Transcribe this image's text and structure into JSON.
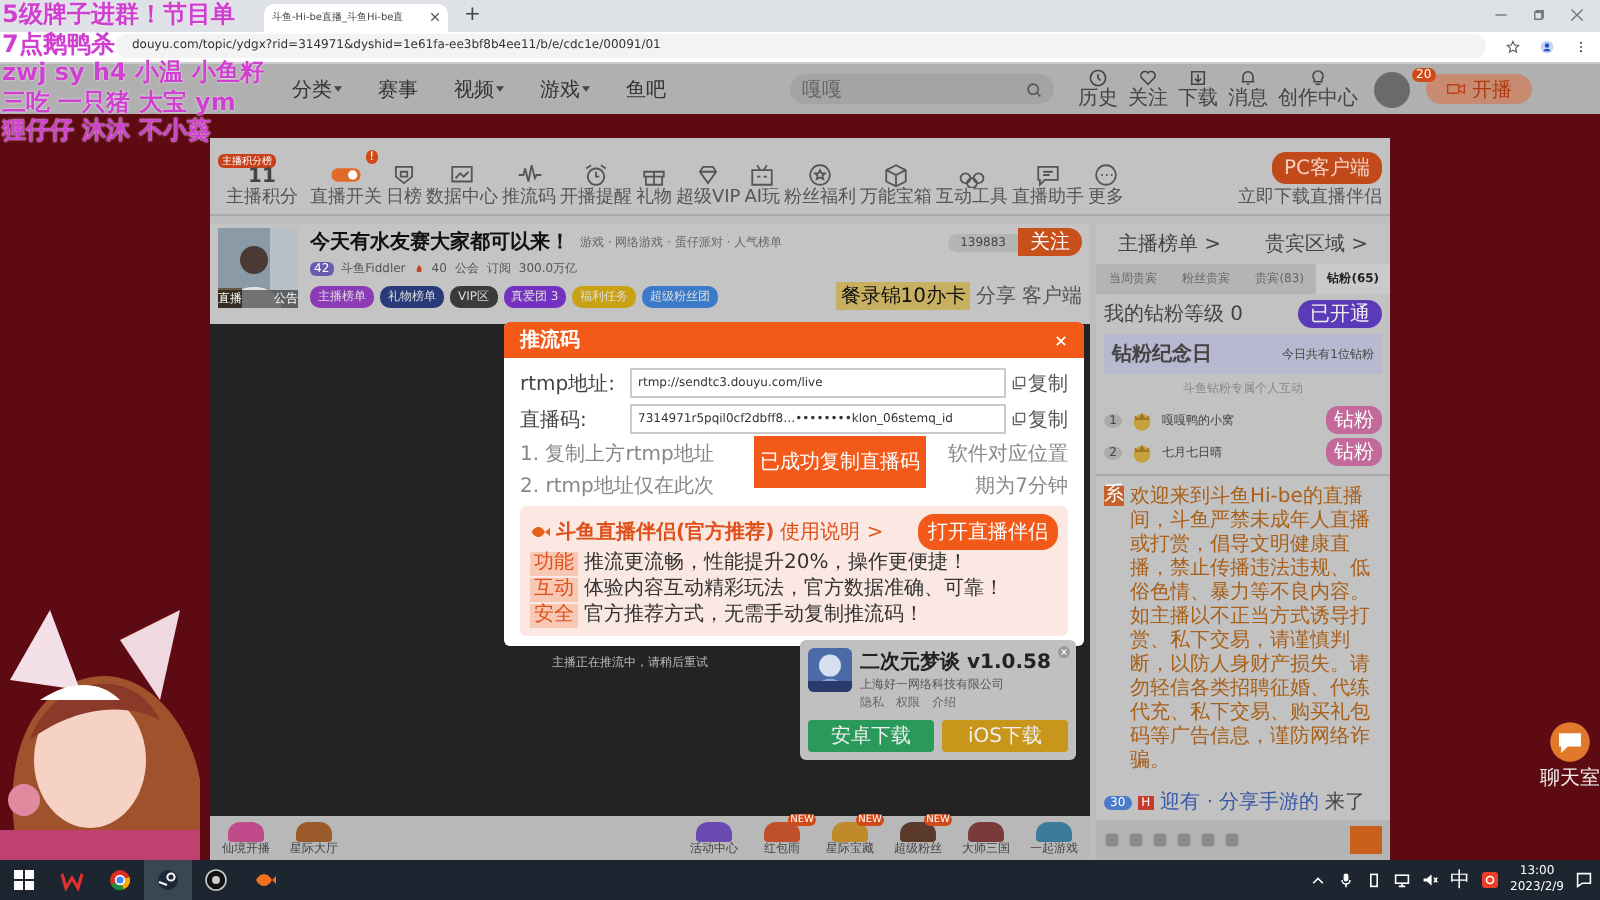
{
  "overlay_text": [
    "5级牌子进群！节目单",
    "7点鹅鸭杀",
    "zwj sy h4 小温 小鱼籽",
    "三吃 一只猪 大宝 ym",
    "狸仔仔 沐沐 不小葵"
  ],
  "browser": {
    "tab_title": "斗鱼-Hi-be直播_斗鱼Hi-be直",
    "new_tab": "+",
    "url": "douyu.com/topic/ydgx?rid=314971&dyshid=1e61fa-ee3bf8b4ee11/b/e/cdc1e/00091/01"
  },
  "site_header": {
    "nav": [
      {
        "label": "分类",
        "dropdown": true
      },
      {
        "label": "赛事",
        "dropdown": false
      },
      {
        "label": "视频",
        "dropdown": true
      },
      {
        "label": "游戏",
        "dropdown": true
      },
      {
        "label": "鱼吧",
        "dropdown": false
      }
    ],
    "search_placeholder": "嘎嘎",
    "icons": [
      {
        "label": "历史",
        "kind": "clock"
      },
      {
        "label": "关注",
        "kind": "heart"
      },
      {
        "label": "下载",
        "kind": "download"
      },
      {
        "label": "消息",
        "kind": "bell"
      },
      {
        "label": "创作中心",
        "kind": "bulb"
      }
    ],
    "avatar_badge": "20",
    "live_button": "开播"
  },
  "toolbar": {
    "tag": "主播积分榜",
    "score": "11",
    "score_label": "主播积分",
    "items": [
      {
        "label": "直播开关",
        "kind": "toggle",
        "badge": "!",
        "on": true
      },
      {
        "label": "日榜",
        "kind": "shield"
      },
      {
        "label": "数据中心",
        "kind": "chart"
      },
      {
        "label": "推流码",
        "kind": "wave"
      },
      {
        "label": "开播提醒",
        "kind": "alarm"
      },
      {
        "label": "礼物",
        "kind": "gift"
      },
      {
        "label": "超级VIP",
        "kind": "diamond"
      },
      {
        "label": "AI玩",
        "kind": "tv"
      },
      {
        "label": "粉丝福利",
        "kind": "medal"
      },
      {
        "label": "万能宝箱",
        "kind": "box"
      },
      {
        "label": "互动工具",
        "kind": "circles"
      },
      {
        "label": "直播助手",
        "kind": "chat"
      },
      {
        "label": "更多",
        "kind": "more"
      }
    ],
    "client_button": "PC客户端",
    "client_link": "立即下载直播伴侣"
  },
  "room": {
    "thumb_labels": [
      "直播",
      "公告"
    ],
    "title": "今天有水友赛大家都可以来！",
    "category": "游戏 · 网络游戏 · 蛋仔派对 · 人气榜单",
    "level": "42",
    "streamer": "斗鱼Fiddler",
    "heat": "40",
    "guild": "公会",
    "subscribe": "订阅",
    "fans": "300.0万亿",
    "pills": [
      {
        "text": "主播榜单",
        "color": "#8a3bb5"
      },
      {
        "text": "礼物榜单",
        "color": "#293a78"
      },
      {
        "text": "VIP区",
        "color": "#3a3a3a"
      },
      {
        "text": "真爱团 3",
        "color": "#7430c0"
      },
      {
        "text": "福利任务",
        "color": "#c9a214"
      },
      {
        "text": "超级粉丝团",
        "color": "#3a7ac8"
      }
    ],
    "follow_count": "139883",
    "follow_button": "关注",
    "promo": "餐录锦10办卡",
    "share": "分享",
    "client": "客户端",
    "status": "主播正在推流中，请稍后重试"
  },
  "gift_bar": {
    "left": [
      {
        "label": "仙境开播",
        "color": "#c04a8a"
      },
      {
        "label": "星际大厅",
        "color": "#9a5a2a"
      }
    ],
    "right": [
      {
        "label": "活动中心",
        "color": "#6a4ab0"
      },
      {
        "label": "红包雨",
        "color": "#c0502a",
        "badge": "NEW"
      },
      {
        "label": "星际宝藏",
        "color": "#c08a2a",
        "badge": "NEW"
      },
      {
        "label": "超级粉丝",
        "color": "#5a3a2a",
        "badge": "NEW"
      },
      {
        "label": "大师三国",
        "color": "#7a3a3a"
      },
      {
        "label": "一起游戏",
        "color": "#3a7a9a"
      }
    ]
  },
  "sidebar": {
    "links": [
      "主播榜单 >",
      "贵宾区域 >"
    ],
    "tabs": [
      {
        "label": "当周贵宾",
        "selected": false
      },
      {
        "label": "粉丝贵宾",
        "selected": false
      },
      {
        "label": "贵宾(83)",
        "selected": false
      },
      {
        "label": "钻粉(65)",
        "selected": true
      }
    ],
    "my_level": "我的钻粉等级 0",
    "open_button": "已开通",
    "anniv_title": "钻粉纪念日",
    "anniv_note": "今日共有1位钻粉",
    "hint": "斗鱼钻粉专属个人互动",
    "ranks": [
      {
        "rank": "1",
        "name": "嘎嘎鸭的小窝",
        "tag": "钻粉"
      },
      {
        "rank": "2",
        "name": "七月七日晴",
        "tag": "钻粉"
      }
    ],
    "notice_badge": "系",
    "notice": "欢迎来到斗鱼Hi-be的直播间，斗鱼严禁未成年人直播或打赏，倡导文明健康直播，禁止传播违法违规、低俗色情、暴力等不良内容。如主播以不正当方式诱导打赏、私下交易，请谨慎判断，以防人身财产损失。请勿轻信各类招聘征婚、代练代充、私下交易、购买礼包码等广告信息，谨防网络诈骗。",
    "chat": {
      "level": "30",
      "badge": "H",
      "user": "迎有 · 分享手游的",
      "message": "来了"
    }
  },
  "modal": {
    "title": "推流码",
    "rows": [
      {
        "label": "rtmp地址:",
        "value": "rtmp://sendtc3.douyu.com/live",
        "copy": "复制"
      },
      {
        "label": "直播码:",
        "value": "7314971r5pqil0cf2dbff8…••••••••klon_06stemq_id",
        "copy": "复制"
      }
    ],
    "notes": [
      {
        "left": "1. 复制上方rtmp地址",
        "right": "软件对应位置"
      },
      {
        "left": "2. rtmp地址仅在此次",
        "right": "期为7分钟"
      }
    ],
    "toast": "已成功复制直播码",
    "promo_title": "斗鱼直播伴侣(官方推荐)",
    "promo_link": "使用说明 >",
    "promo_button": "打开直播伴侣",
    "features": [
      {
        "tag": "功能",
        "text": "推流更流畅，性能提升20%，操作更便捷！"
      },
      {
        "tag": "互动",
        "text": "体验内容互动精彩玩法，官方数据准确、可靠！"
      },
      {
        "tag": "安全",
        "text": "官方推荐方式，无需手动复制推流码！"
      }
    ]
  },
  "app_popup": {
    "name": "二次元梦谈 v1.0.58",
    "company": "上海好一网络科技有限公司",
    "links": [
      "隐私",
      "权限",
      "介绍"
    ],
    "android": "安卓下载",
    "ios": "iOS下载"
  },
  "chat_float": "聊天室",
  "taskbar": {
    "ime": "中",
    "time": "13:00",
    "date": "2023/2/9"
  }
}
